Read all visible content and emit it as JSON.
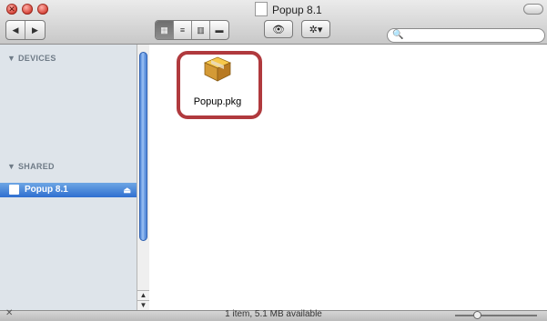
{
  "window": {
    "title": "Popup 8.1"
  },
  "toolbar": {
    "back_glyph": "◀",
    "forward_glyph": "▶",
    "view_icons": [
      "icon-view-icon",
      "list-view-icon",
      "column-view-icon",
      "cover-flow-icon"
    ],
    "view_glyphs": [
      "▦",
      "≡",
      "▥",
      "▬"
    ],
    "quicklook_glyph": "👁",
    "action_glyph": "✲▾",
    "search": {
      "value": "",
      "placeholder": ""
    }
  },
  "sidebar": {
    "devices_header": "▼ DEVICES",
    "shared_header": "▼ SHARED",
    "selected_item": {
      "label": "Popup 8.1",
      "eject": "⏏"
    }
  },
  "content": {
    "files": [
      {
        "name": "Popup.pkg",
        "icon": "package-icon"
      }
    ]
  },
  "status": {
    "text": "1 item, 5.1 MB available"
  },
  "colors": {
    "highlight": "#b03a3e",
    "sidebar_bg": "#dee4ea",
    "selection": "#2f6fd0"
  }
}
